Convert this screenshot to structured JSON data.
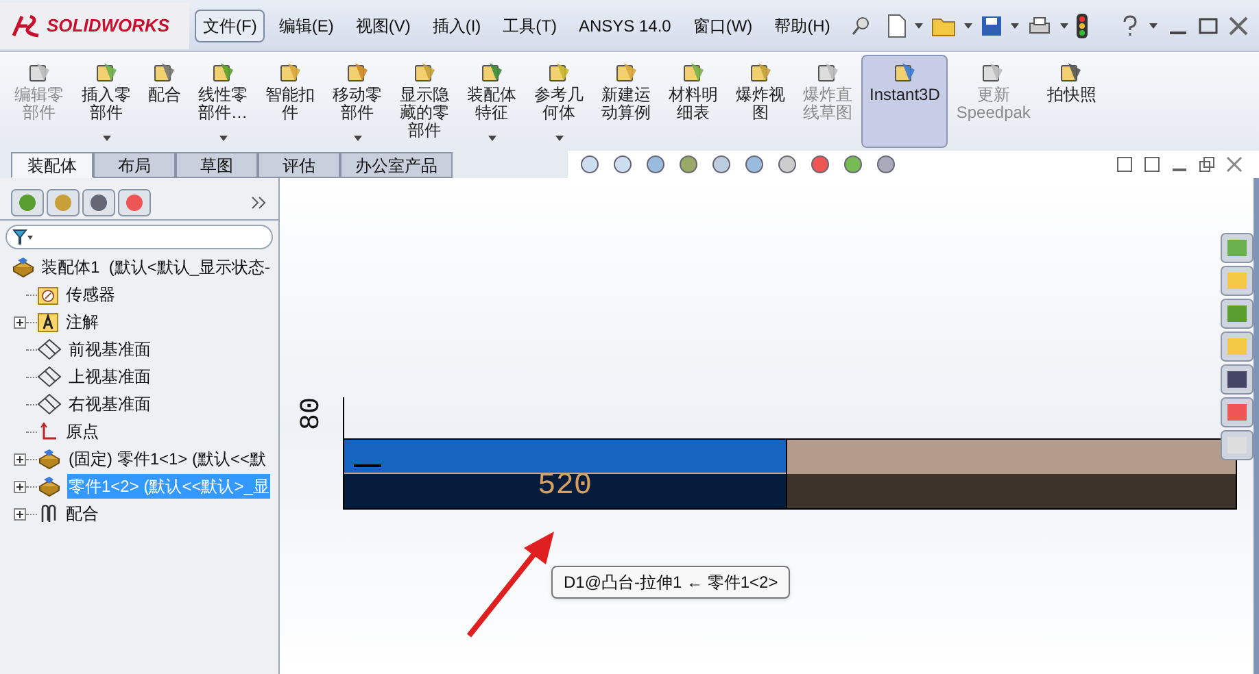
{
  "logo": {
    "text": "SOLIDWORKS"
  },
  "menu": [
    {
      "label": "文件(F)",
      "selected": true
    },
    {
      "label": "编辑(E)",
      "selected": false
    },
    {
      "label": "视图(V)",
      "selected": false
    },
    {
      "label": "插入(I)",
      "selected": false
    },
    {
      "label": "工具(T)",
      "selected": false
    },
    {
      "label": "ANSYS 14.0",
      "selected": false
    },
    {
      "label": "窗口(W)",
      "selected": false
    },
    {
      "label": "帮助(H)",
      "selected": false
    }
  ],
  "ribbon": [
    {
      "label": "编辑零部件",
      "disabled": true,
      "dropdown": false,
      "selected": false
    },
    {
      "label": "插入零部件",
      "disabled": false,
      "dropdown": true,
      "selected": false
    },
    {
      "label": "配合",
      "disabled": false,
      "dropdown": false,
      "selected": false
    },
    {
      "label": "线性零部件…",
      "disabled": false,
      "dropdown": true,
      "selected": false
    },
    {
      "label": "智能扣件",
      "disabled": false,
      "dropdown": false,
      "selected": false
    },
    {
      "label": "移动零部件",
      "disabled": false,
      "dropdown": true,
      "selected": false
    },
    {
      "label": "显示隐藏的零部件",
      "disabled": false,
      "dropdown": false,
      "selected": false
    },
    {
      "label": "装配体特征",
      "disabled": false,
      "dropdown": true,
      "selected": false
    },
    {
      "label": "参考几何体",
      "disabled": false,
      "dropdown": true,
      "selected": false
    },
    {
      "label": "新建运动算例",
      "disabled": false,
      "dropdown": false,
      "selected": false
    },
    {
      "label": "材料明细表",
      "disabled": false,
      "dropdown": false,
      "selected": false
    },
    {
      "label": "爆炸视图",
      "disabled": false,
      "dropdown": false,
      "selected": false
    },
    {
      "label": "爆炸直线草图",
      "disabled": true,
      "dropdown": false,
      "selected": false
    },
    {
      "label": "Instant3D",
      "disabled": false,
      "dropdown": false,
      "selected": true
    },
    {
      "label": "更新 Speedpak",
      "disabled": true,
      "dropdown": false,
      "selected": false
    },
    {
      "label": "拍快照",
      "disabled": false,
      "dropdown": false,
      "selected": false
    }
  ],
  "tabs": [
    {
      "label": "装配体",
      "selected": true
    },
    {
      "label": "布局",
      "selected": false
    },
    {
      "label": "草图",
      "selected": false
    },
    {
      "label": "评估",
      "selected": false
    },
    {
      "label": "办公室产品",
      "selected": false
    }
  ],
  "tree": {
    "label": "装配体1  (默认<默认_显示状态-",
    "children": [
      {
        "label": "传感器",
        "kind": "sensor",
        "expandable": false,
        "selected": false
      },
      {
        "label": "注解",
        "kind": "annotation",
        "expandable": true,
        "selected": false
      },
      {
        "label": "前视基准面",
        "kind": "plane",
        "expandable": false,
        "selected": false
      },
      {
        "label": "上视基准面",
        "kind": "plane",
        "expandable": false,
        "selected": false
      },
      {
        "label": "右视基准面",
        "kind": "plane",
        "expandable": false,
        "selected": false
      },
      {
        "label": "原点",
        "kind": "origin",
        "expandable": false,
        "selected": false
      },
      {
        "label": "(固定) 零件1<1> (默认<<默",
        "kind": "part",
        "expandable": true,
        "selected": false
      },
      {
        "label": "零件1<2> (默认<<默认>_显",
        "kind": "part",
        "expandable": true,
        "selected": true
      },
      {
        "label": "配合",
        "kind": "mate",
        "expandable": true,
        "selected": false
      }
    ]
  },
  "canvas": {
    "vertical_dimension": "80",
    "horizontal_dimension": "520",
    "tooltip": "D1@凸台-拉伸1 ← 零件1<2>"
  }
}
